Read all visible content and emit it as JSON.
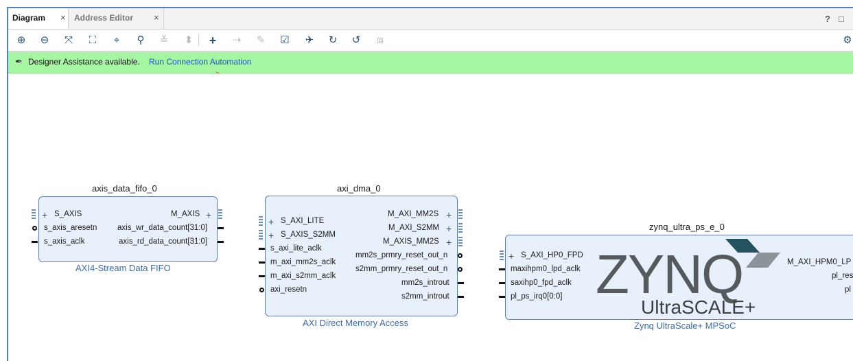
{
  "tabs": {
    "diagram": "Diagram",
    "address_editor": "Address Editor",
    "close": "×"
  },
  "window": {
    "help": "?",
    "maximize": "□"
  },
  "assist": {
    "message": "Designer Assistance available.",
    "link": "Run Connection Automation"
  },
  "colors": {
    "accent": "#4f7fd6",
    "assist_bg": "#a5f5a3",
    "link": "#1a55c8",
    "block_fill": "#e8f1fb"
  },
  "blocks": {
    "fifo": {
      "name": "axis_data_fifo_0",
      "subtitle": "AXI4-Stream Data FIFO",
      "left_ports": [
        "S_AXIS",
        "s_axis_aresetn",
        "s_axis_aclk"
      ],
      "right_ports": [
        "M_AXIS",
        "axis_wr_data_count[31:0]",
        "axis_rd_data_count[31:0]"
      ]
    },
    "dma": {
      "name": "axi_dma_0",
      "subtitle": "AXI Direct Memory Access",
      "left_ports": [
        "S_AXI_LITE",
        "S_AXIS_S2MM",
        "s_axi_lite_aclk",
        "m_axi_mm2s_aclk",
        "m_axi_s2mm_aclk",
        "axi_resetn"
      ],
      "right_ports": [
        "M_AXI_MM2S",
        "M_AXI_S2MM",
        "M_AXIS_MM2S",
        "mm2s_prmry_reset_out_n",
        "s2mm_prmry_reset_out_n",
        "mm2s_introut",
        "s2mm_introut"
      ]
    },
    "zynq": {
      "name": "zynq_ultra_ps_e_0",
      "subtitle": "Zynq UltraScale+ MPSoC",
      "logo_main": "ZYNQ",
      "logo_sub": "UltraSCALE+",
      "left_ports": [
        "S_AXI_HP0_FPD",
        "maxihpm0_lpd_aclk",
        "saxihp0_fpd_aclk",
        "pl_ps_irq0[0:0]"
      ],
      "right_ports": [
        "M_AXI_HPM0_LP",
        "pl_res",
        "pl"
      ]
    }
  }
}
